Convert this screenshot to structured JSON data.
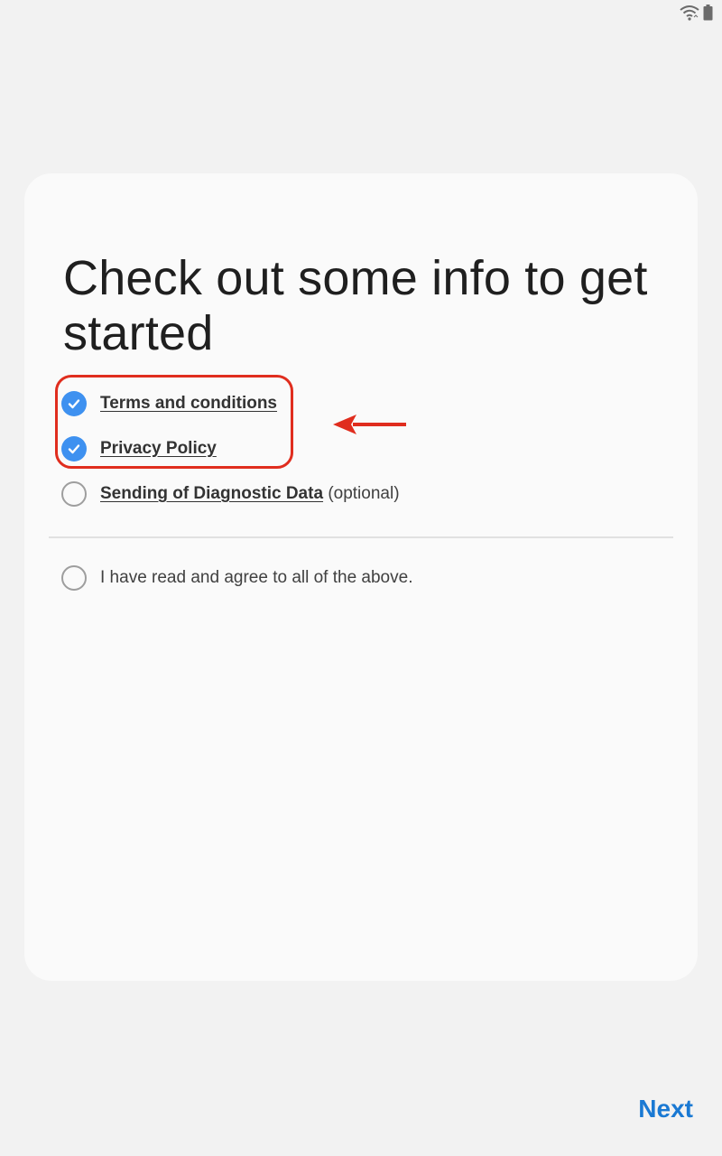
{
  "header": {
    "title": "Check out some info to get started"
  },
  "agreements": [
    {
      "label": "Terms and conditions",
      "checked": true
    },
    {
      "label": "Privacy Policy",
      "checked": true
    },
    {
      "label": "Sending of Diagnostic Data",
      "suffix": "(optional)",
      "checked": false
    }
  ],
  "agree_all": {
    "label": "I have read and agree to all of the above.",
    "checked": false
  },
  "footer": {
    "next_label": "Next"
  },
  "colors": {
    "accent": "#1a79d3",
    "checkbox_checked": "#3e91f0",
    "annotation": "#e02d1e"
  },
  "icons": {
    "status": [
      "wifi-icon",
      "battery-icon"
    ],
    "checkbox": "checkmark-icon",
    "annotation": "arrow-left-icon"
  }
}
